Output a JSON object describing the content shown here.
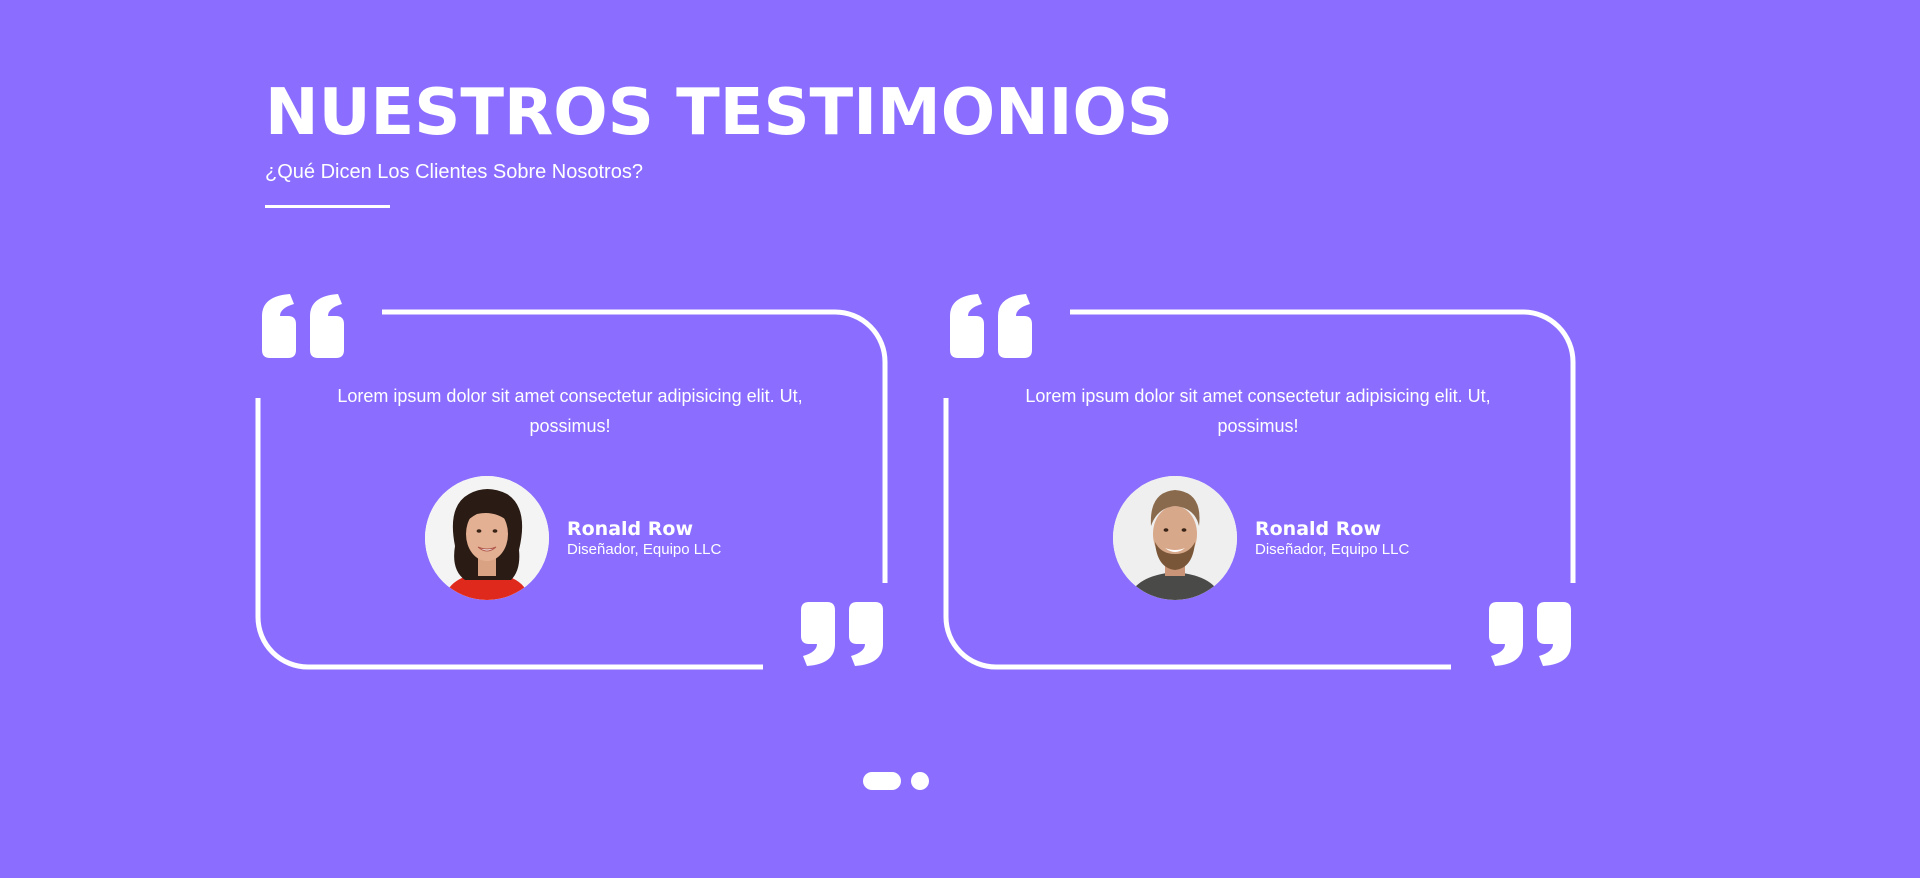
{
  "section": {
    "title": "NUESTROS TESTIMONIOS",
    "subtitle": "¿Qué Dicen Los Clientes Sobre Nosotros?"
  },
  "colors": {
    "background": "#8b6eff",
    "foreground": "#ffffff"
  },
  "testimonials": [
    {
      "text": "Lorem ipsum dolor sit amet consectetur adipisicing elit. Ut, possimus!",
      "author_name": "Ronald Row",
      "author_role": "Diseñador, Equipo LLC",
      "avatar": "woman-portrait-photo"
    },
    {
      "text": "Lorem ipsum dolor sit amet consectetur adipisicing elit. Ut, possimus!",
      "author_name": "Ronald Row",
      "author_role": "Diseñador, Equipo LLC",
      "avatar": "man-portrait-photo"
    }
  ],
  "pagination": {
    "total": 2,
    "active": 1
  }
}
